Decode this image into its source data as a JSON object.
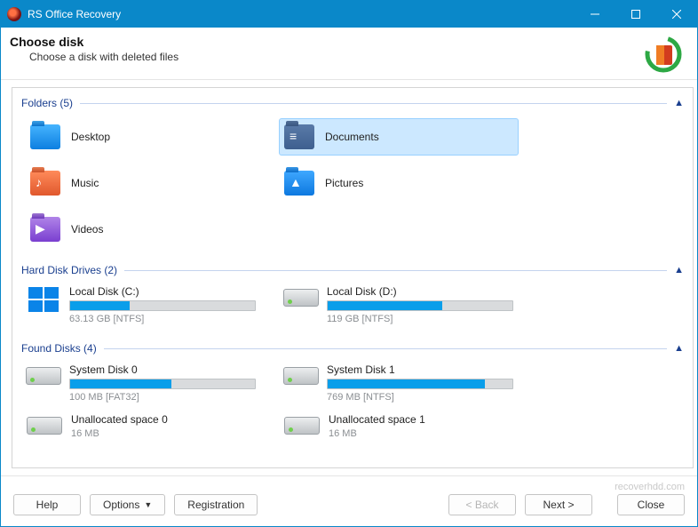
{
  "app": {
    "title": "RS Office Recovery"
  },
  "header": {
    "heading": "Choose disk",
    "sub": "Choose a disk with deleted files"
  },
  "sections": {
    "folders": {
      "title": "Folders (5)"
    },
    "hdd": {
      "title": "Hard Disk Drives (2)"
    },
    "found": {
      "title": "Found Disks (4)"
    }
  },
  "folders": [
    {
      "label": "Desktop",
      "type": "desktop",
      "selected": false
    },
    {
      "label": "Documents",
      "type": "docs",
      "selected": true
    },
    {
      "label": "Music",
      "type": "music",
      "selected": false
    },
    {
      "label": "Pictures",
      "type": "pics",
      "selected": false
    },
    {
      "label": "Videos",
      "type": "videos",
      "selected": false
    }
  ],
  "hdd": [
    {
      "name": "Local Disk (C:)",
      "meta": "63.13 GB [NTFS]",
      "fill": 32,
      "icon": "winlogo"
    },
    {
      "name": "Local Disk (D:)",
      "meta": "119 GB [NTFS]",
      "fill": 62,
      "icon": "hdd"
    }
  ],
  "found": [
    {
      "name": "System Disk 0",
      "meta": "100 MB [FAT32]",
      "fill": 55,
      "icon": "hdd"
    },
    {
      "name": "System Disk 1",
      "meta": "769 MB [NTFS]",
      "fill": 85,
      "icon": "hdd"
    },
    {
      "name": "Unallocated space 0",
      "meta": "16 MB",
      "fill": null,
      "icon": "hdd"
    },
    {
      "name": "Unallocated space 1",
      "meta": "16 MB",
      "fill": null,
      "icon": "hdd"
    }
  ],
  "footer": {
    "watermark": "recoverhdd.com",
    "help": "Help",
    "options": "Options",
    "registration": "Registration",
    "back": "< Back",
    "next": "Next >",
    "close": "Close"
  }
}
